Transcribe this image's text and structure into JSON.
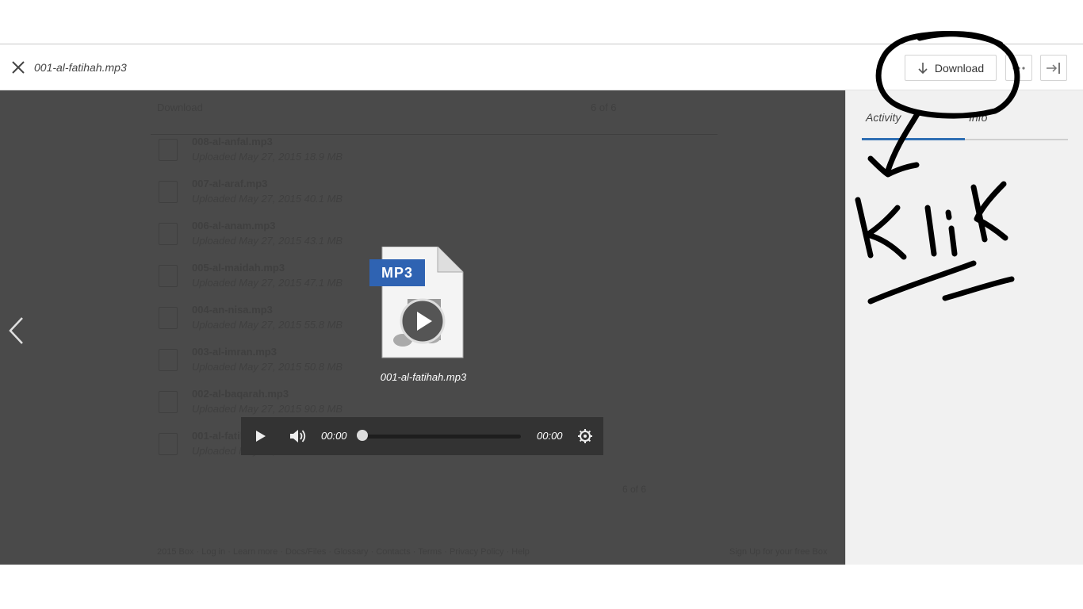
{
  "header": {
    "file_name": "001-al-fatihah.mp3",
    "download_label": "Download"
  },
  "background_list": {
    "toolbar_download": "Download",
    "pager": "6 of 6",
    "bottom_pager": "6 of 6",
    "rows": [
      {
        "name": "008-al-anfal.mp3",
        "meta": "Uploaded May 27, 2015     18.9 MB"
      },
      {
        "name": "007-al-araf.mp3",
        "meta": "Uploaded May 27, 2015     40.1 MB"
      },
      {
        "name": "006-al-anam.mp3",
        "meta": "Uploaded May 27, 2015     43.1 MB"
      },
      {
        "name": "005-al-maidah.mp3",
        "meta": "Uploaded May 27, 2015     47.1 MB"
      },
      {
        "name": "004-an-nisa.mp3",
        "meta": "Uploaded May 27, 2015     55.8 MB"
      },
      {
        "name": "003-al-imran.mp3",
        "meta": "Uploaded May 27, 2015     50.8 MB"
      },
      {
        "name": "002-al-baqarah.mp3",
        "meta": "Uploaded May 27, 2015     90.8 MB"
      },
      {
        "name": "001-al-fatihah.mp3",
        "meta": "Uploaded May 27, 2015"
      }
    ],
    "footer_links": "2015 Box · Log in · Learn more · Docs/Files · Glossary · Contacts · Terms · Privacy Policy · Help",
    "footer_right": "Sign Up for your free Box"
  },
  "preview": {
    "badge": "MP3",
    "caption": "001-al-fatihah.mp3"
  },
  "player": {
    "current_time": "00:00",
    "duration": "00:00",
    "progress": 0
  },
  "sidebar": {
    "tabs": [
      {
        "label": "Activity",
        "active": true
      },
      {
        "label": "Info",
        "active": false
      }
    ]
  },
  "annotation": {
    "handwritten_text": "KliK"
  },
  "colors": {
    "accent": "#2f6fb3",
    "mp3_badge": "#2f63b2",
    "overlay": "#4a4a4a"
  }
}
